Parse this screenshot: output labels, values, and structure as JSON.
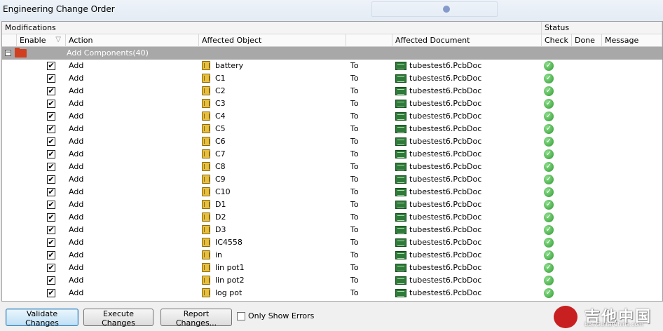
{
  "window": {
    "title": "Engineering Change Order"
  },
  "groups": {
    "modifications": "Modifications",
    "status": "Status"
  },
  "columns": {
    "enable": "Enable",
    "action": "Action",
    "affected_object": "Affected Object",
    "affected_document": "Affected Document",
    "check": "Check",
    "done": "Done",
    "message": "Message"
  },
  "group_row": {
    "label": "Add Components(40)",
    "expander": "−"
  },
  "rows": [
    {
      "enabled": "✔",
      "action": "Add",
      "object": "battery",
      "to": "To",
      "document": "tubestest6.PcbDoc",
      "check": "✓"
    },
    {
      "enabled": "✔",
      "action": "Add",
      "object": "C1",
      "to": "To",
      "document": "tubestest6.PcbDoc",
      "check": "✓"
    },
    {
      "enabled": "✔",
      "action": "Add",
      "object": "C2",
      "to": "To",
      "document": "tubestest6.PcbDoc",
      "check": "✓"
    },
    {
      "enabled": "✔",
      "action": "Add",
      "object": "C3",
      "to": "To",
      "document": "tubestest6.PcbDoc",
      "check": "✓"
    },
    {
      "enabled": "✔",
      "action": "Add",
      "object": "C4",
      "to": "To",
      "document": "tubestest6.PcbDoc",
      "check": "✓"
    },
    {
      "enabled": "✔",
      "action": "Add",
      "object": "C5",
      "to": "To",
      "document": "tubestest6.PcbDoc",
      "check": "✓"
    },
    {
      "enabled": "✔",
      "action": "Add",
      "object": "C6",
      "to": "To",
      "document": "tubestest6.PcbDoc",
      "check": "✓"
    },
    {
      "enabled": "✔",
      "action": "Add",
      "object": "C7",
      "to": "To",
      "document": "tubestest6.PcbDoc",
      "check": "✓"
    },
    {
      "enabled": "✔",
      "action": "Add",
      "object": "C8",
      "to": "To",
      "document": "tubestest6.PcbDoc",
      "check": "✓"
    },
    {
      "enabled": "✔",
      "action": "Add",
      "object": "C9",
      "to": "To",
      "document": "tubestest6.PcbDoc",
      "check": "✓"
    },
    {
      "enabled": "✔",
      "action": "Add",
      "object": "C10",
      "to": "To",
      "document": "tubestest6.PcbDoc",
      "check": "✓"
    },
    {
      "enabled": "✔",
      "action": "Add",
      "object": "D1",
      "to": "To",
      "document": "tubestest6.PcbDoc",
      "check": "✓"
    },
    {
      "enabled": "✔",
      "action": "Add",
      "object": "D2",
      "to": "To",
      "document": "tubestest6.PcbDoc",
      "check": "✓"
    },
    {
      "enabled": "✔",
      "action": "Add",
      "object": "D3",
      "to": "To",
      "document": "tubestest6.PcbDoc",
      "check": "✓"
    },
    {
      "enabled": "✔",
      "action": "Add",
      "object": "IC4558",
      "to": "To",
      "document": "tubestest6.PcbDoc",
      "check": "✓"
    },
    {
      "enabled": "✔",
      "action": "Add",
      "object": "in",
      "to": "To",
      "document": "tubestest6.PcbDoc",
      "check": "✓"
    },
    {
      "enabled": "✔",
      "action": "Add",
      "object": "lin pot1",
      "to": "To",
      "document": "tubestest6.PcbDoc",
      "check": "✓"
    },
    {
      "enabled": "✔",
      "action": "Add",
      "object": "lin pot2",
      "to": "To",
      "document": "tubestest6.PcbDoc",
      "check": "✓"
    },
    {
      "enabled": "✔",
      "action": "Add",
      "object": "log pot",
      "to": "To",
      "document": "tubestest6.PcbDoc",
      "check": "✓"
    }
  ],
  "buttons": {
    "validate": "Validate Changes",
    "execute": "Execute Changes",
    "report": "Report Changes..."
  },
  "only_show_errors": "Only Show Errors",
  "watermark": {
    "big": "吉他中国",
    "small": "bbs.GuitarChina.com"
  },
  "colors": {
    "group_row_bg": "#a8a8a8",
    "focus_border": "#3c7fb1",
    "check_green": "#2f9a2f"
  }
}
